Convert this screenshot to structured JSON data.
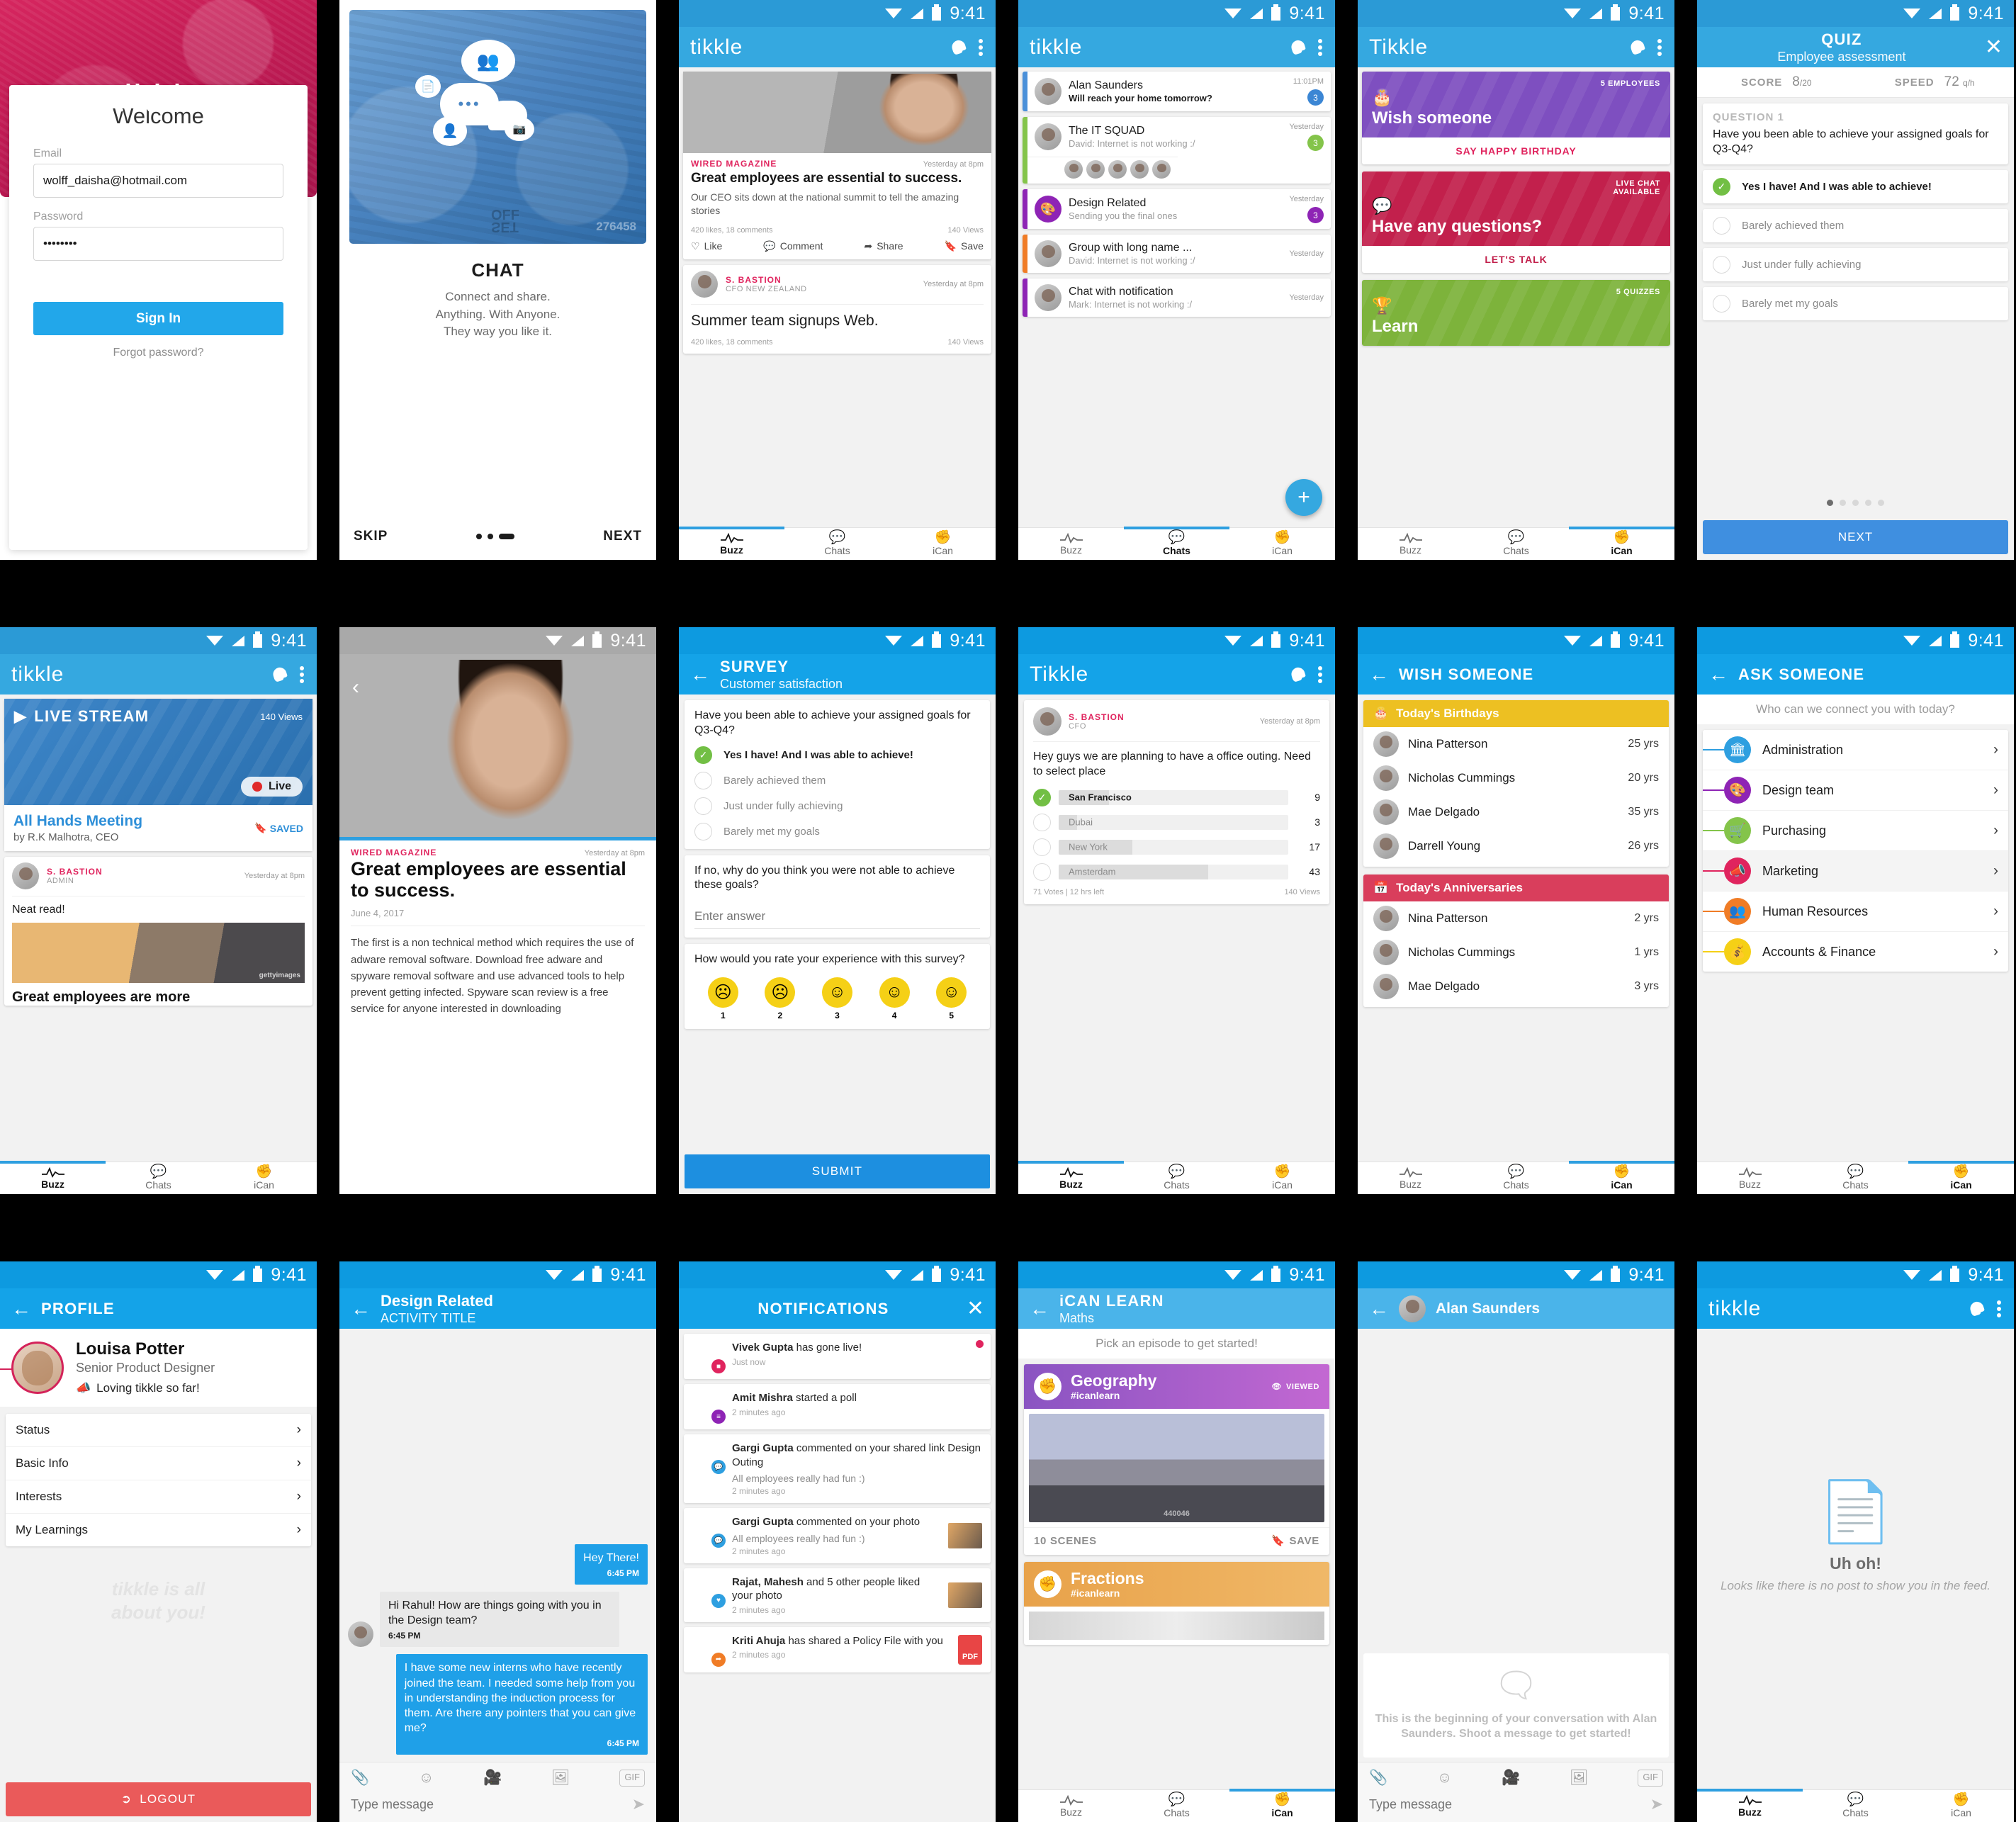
{
  "app": {
    "brand_lower": "tikkle",
    "brand_cap": "Tikkle",
    "status_time": "9:41"
  },
  "login": {
    "logo": "tikkle",
    "title": "Welcome",
    "email_label": "Email",
    "email_value": "wolff_daisha@hotmail.com",
    "password_label": "Password",
    "password_value": "••••••••",
    "signin_label": "Sign In",
    "forgot_label": "Forgot password?"
  },
  "onboarding": {
    "title": "CHAT",
    "desc_line1": "Connect and share.",
    "desc_line2": "Anything. With Anyone.",
    "desc_line3": "They way you like it.",
    "skip": "SKIP",
    "next": "NEXT",
    "watermark1": "OFF",
    "watermark2": "SET",
    "watermark3": "276458"
  },
  "buzz_feed": {
    "post1": {
      "source": "WIRED MAGAZINE",
      "time": "Yesterday at 8pm",
      "headline": "Great employees are essential to success.",
      "excerpt": "Our CEO sits down at the national summit to tell the amazing stories",
      "stats": "420 likes, 18 comments",
      "views": "140 Views",
      "actions": [
        "Like",
        "Comment",
        "Share",
        "Save"
      ]
    },
    "post2": {
      "author": "S. BASTION",
      "role": "CFO NEW ZEALAND",
      "time": "Yesterday at 8pm",
      "headline": "Summer team signups Web.",
      "stats": "420 likes, 18 comments",
      "views": "140 Views"
    }
  },
  "nav": {
    "buzz": "Buzz",
    "chats": "Chats",
    "ican": "iCan"
  },
  "chat_list": {
    "rows": [
      {
        "name": "Alan Saunders",
        "last": "Will reach your home tomorrow?",
        "time": "11:01PM",
        "badge": "3",
        "color": "#4a90d9",
        "unread": true
      },
      {
        "name": "The IT SQUAD",
        "last": "David: Internet is not working :/",
        "time": "Yesterday",
        "badge": "3",
        "color": "#84c44a",
        "members": 5
      },
      {
        "name": "Design Related",
        "last": "Sending you the final ones",
        "time": "Yesterday",
        "badge": "3",
        "color": "#8e24b5",
        "icon": "palette-icon"
      },
      {
        "name": "Group with long name ...",
        "last": "David: Internet is not working :/",
        "time": "Yesterday",
        "badge": "",
        "color": "#f07c26"
      },
      {
        "name": "Chat with notification",
        "last": "Mark: Internet is not working :/",
        "time": "Yesterday",
        "badge": "",
        "color": "#8e24b5"
      }
    ],
    "fab_label": "+"
  },
  "ican_home": {
    "cards": [
      {
        "tag": "5 EMPLOYEES",
        "title": "Wish someone",
        "cta": "SAY HAPPY BIRTHDAY",
        "color": "#7e4fc0",
        "cta_color": "#e0245e",
        "icon": "cake-icon"
      },
      {
        "tag": "LIVE CHAT\nAVAILABLE",
        "title": "Have any questions?",
        "cta": "LET'S TALK",
        "color": "#c2204c",
        "cta_color": "#c2204c",
        "icon": "question-chat-icon"
      },
      {
        "tag": "5 QUIZZES",
        "title": "Learn",
        "cta": "",
        "color": "#7db33b",
        "cta_color": "#7db33b",
        "icon": "trophy-icon"
      }
    ]
  },
  "quiz": {
    "title": "QUIZ",
    "subtitle": "Employee assessment",
    "score_label": "SCORE",
    "score_value": "8",
    "score_total": "/20",
    "speed_label": "SPEED",
    "speed_value": "72",
    "speed_unit": "q/h",
    "question_label": "QUESTION 1",
    "question": "Have you been able to achieve your assigned goals for Q3-Q4?",
    "options": [
      {
        "text": "Yes I have! And I was able to achieve!",
        "selected": true
      },
      {
        "text": "Barely achieved them",
        "selected": false
      },
      {
        "text": "Just under fully achieving",
        "selected": false
      },
      {
        "text": "Barely met my goals",
        "selected": false
      }
    ],
    "pages": 5,
    "active_page": 1,
    "next_label": "NEXT"
  },
  "live_stream": {
    "label": "LIVE STREAM",
    "views": "140 Views",
    "live_badge": "Live",
    "title": "All Hands Meeting",
    "byline": "by R.K Malhotra, CEO",
    "saved_label": "SAVED",
    "post": {
      "author": "S. BASTION",
      "role": "ADMIN",
      "time": "Yesterday at 8pm",
      "text": "Neat read!",
      "headline": "Great employees are more",
      "watermark": "gettyimages"
    }
  },
  "article": {
    "source": "WIRED MAGAZINE",
    "time": "Yesterday at 8pm",
    "headline": "Great employees are essential to success.",
    "date": "June 4, 2017",
    "body": "The first is a non technical method which requires the use of adware removal software. Download free adware and spyware removal software and use advanced tools to help prevent getting infected. Spyware scan review is a free service for anyone interested in downloading"
  },
  "survey": {
    "title": "SURVEY",
    "subtitle": "Customer satisfaction",
    "q1": "Have you been able to achieve your assigned goals for Q3-Q4?",
    "options": [
      {
        "text": "Yes I have! And I was able to achieve!",
        "selected": true
      },
      {
        "text": "Barely achieved them",
        "selected": false
      },
      {
        "text": "Just under fully achieving",
        "selected": false
      },
      {
        "text": "Barely met my goals",
        "selected": false
      }
    ],
    "q2": "If no, why do you think you were not able to achieve these goals?",
    "answer_placeholder": "Enter answer",
    "q3": "How would you rate your experience with this survey?",
    "faces": [
      {
        "num": "1",
        "glyph": "☹"
      },
      {
        "num": "2",
        "glyph": "ὤ1"
      },
      {
        "num": "3",
        "glyph": "—"
      },
      {
        "num": "4",
        "glyph": "☺"
      },
      {
        "num": "5",
        "glyph": "ὠ3"
      }
    ],
    "submit_label": "SUBMIT"
  },
  "poll": {
    "author": "S. BASTION",
    "role": "CFO",
    "time": "Yesterday at 8pm",
    "question": "Hey guys we are planning to have a office outing. Need to select place",
    "options": [
      {
        "label": "San Francisco",
        "votes": "9",
        "pct": 22,
        "selected": true
      },
      {
        "label": "Dubai",
        "votes": "3",
        "pct": 8,
        "selected": false
      },
      {
        "label": "New York",
        "votes": "17",
        "pct": 32,
        "selected": false
      },
      {
        "label": "Amsterdam",
        "votes": "43",
        "pct": 65,
        "selected": false
      }
    ],
    "footer_left": "71 Votes  |  12 hrs left",
    "footer_right": "140 Views"
  },
  "wish": {
    "header": "WISH SOMEONE",
    "birthdays_title": "Today's Birthdays",
    "birthdays": [
      {
        "name": "Nina Patterson",
        "value": "25 yrs"
      },
      {
        "name": "Nicholas Cummings",
        "value": "20 yrs"
      },
      {
        "name": "Mae Delgado",
        "value": "35 yrs"
      },
      {
        "name": "Darrell Young",
        "value": "26 yrs"
      }
    ],
    "anniversaries_title": "Today's Anniversaries",
    "anniversaries": [
      {
        "name": "Nina Patterson",
        "value": "2 yrs"
      },
      {
        "name": "Nicholas Cummings",
        "value": "1 yrs"
      },
      {
        "name": "Mae Delgado",
        "value": "3 yrs"
      }
    ]
  },
  "ask": {
    "header": "ASK SOMEONE",
    "subtitle": "Who can we connect you with today?",
    "departments": [
      {
        "name": "Administration",
        "color": "#2e9fe0",
        "icon": "bank-icon"
      },
      {
        "name": "Design team",
        "color": "#8e24b5",
        "icon": "palette-icon"
      },
      {
        "name": "Purchasing",
        "color": "#84c44a",
        "icon": "cart-icon"
      },
      {
        "name": "Marketing",
        "color": "#e0245e",
        "icon": "megaphone-icon",
        "highlighted": true
      },
      {
        "name": "Human Resources",
        "color": "#f07c26",
        "icon": "people-icon"
      },
      {
        "name": "Accounts & Finance",
        "color": "#f5d016",
        "icon": "money-icon"
      }
    ]
  },
  "profile": {
    "header": "PROFILE",
    "name": "Louisa Potter",
    "role": "Senior Product Designer",
    "status": "Loving tikkle so far!",
    "menu": [
      "Status",
      "Basic Info",
      "Interests",
      "My Learnings"
    ],
    "watermark_line1": "tikkle is all",
    "watermark_line2": "about you!",
    "logout_label": "LOGOUT"
  },
  "chat_detail": {
    "title": "Design Related",
    "subtitle": "ACTIVITY TITLE",
    "messages": [
      {
        "dir": "out",
        "text": "Hey There!",
        "time": "6:45 PM"
      },
      {
        "dir": "in",
        "text": "Hi Rahul! How are things going with you in the Design team?",
        "time": "6:45 PM"
      },
      {
        "dir": "out",
        "text": "I have some new interns who have recently joined the team. I needed some help from you in understanding the induction process for them. Are there any pointers that you can give me?",
        "time": "6:45 PM"
      }
    ],
    "composer_placeholder": "Type message",
    "gif_label": "GIF"
  },
  "notifications": {
    "header": "NOTIFICATIONS",
    "items": [
      {
        "actor": "Vivek Gupta",
        "text": " has gone live!",
        "sub": "",
        "time": "Just now",
        "badge_color": "#e0245e",
        "badge": "●",
        "unread": true
      },
      {
        "actor": "Amit Mishra",
        "text": " started a poll",
        "sub": "",
        "time": "2 minutes ago",
        "badge_color": "#8e24b5",
        "badge": "≡"
      },
      {
        "actor": "Gargi Gupta",
        "text": " commented on your shared link Design Outing",
        "sub": "All employees really had fun :)",
        "time": "2 minutes ago",
        "badge_color": "#2e9fe0",
        "badge": "●"
      },
      {
        "actor": "Gargi Gupta",
        "text": " commented on your photo",
        "sub": "All employees really had fun :)",
        "time": "2 minutes ago",
        "badge_color": "#2e9fe0",
        "badge": "●",
        "thumb": "photo"
      },
      {
        "actor": "Rajat, Mahesh",
        "text": " and 5 other people liked your photo",
        "sub": "",
        "time": "2 minutes ago",
        "badge_color": "#2e9fe0",
        "badge": "♥",
        "thumb": "photo"
      },
      {
        "actor": "Kriti Ahuja",
        "text": " has shared a Policy File with you",
        "sub": "",
        "time": "2 minutes ago",
        "badge_color": "#f07c26",
        "badge": "➦",
        "thumb": "pdf",
        "pdf_label": "PDF"
      }
    ]
  },
  "learn": {
    "header": "iCAN LEARN",
    "subheader": "Maths",
    "prompt": "Pick an episode to get started!",
    "episodes": [
      {
        "name": "Geography",
        "tag": "#icanlearn",
        "color1": "#8a54c2",
        "color2": "#c368d2",
        "viewed": "VIEWED",
        "scenes": "10 SCENES",
        "save": "SAVE",
        "watermark": "440046"
      },
      {
        "name": "Fractions",
        "tag": "#icanlearn",
        "color1": "#e8a24a",
        "color2": "#f0b868"
      }
    ]
  },
  "empty_chat": {
    "title": "Alan Saunders",
    "message": "This is the beginning of your conversation with Alan Saunders. Shoot a message to get started!",
    "composer_placeholder": "Type message",
    "gif_label": "GIF"
  },
  "empty_feed": {
    "title": "Uh oh!",
    "subtitle": "Looks like there is no post to show you in the feed."
  }
}
